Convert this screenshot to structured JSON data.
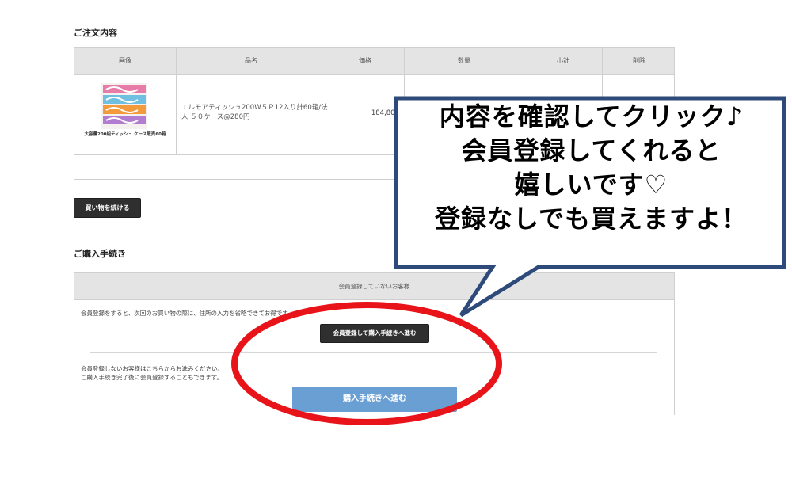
{
  "order": {
    "title": "ご注文内容",
    "headers": [
      "画像",
      "品名",
      "価格",
      "数量",
      "小計",
      "削除"
    ],
    "item": {
      "image_caption": "大容量200組ティッシュ ケース販売60箱",
      "name": "エルモアティッシュ200W５Ｐ12入り計60箱/法人 ５０ケース@280円",
      "price": "184,800"
    },
    "continue_button": "買い物を続ける"
  },
  "procedure": {
    "title": "ご購入手続き",
    "header": "会員登録していないお客様",
    "register_note": "会員登録をすると、次回のお買い物の際に、住所の入力を省略できてお得です。",
    "register_button": "会員登録して購入手続きへ進む",
    "guest_note_1": "会員登録しないお客様はこちらからお進みください。",
    "guest_note_2": "ご購入手続き完了後に会員登録することもできます。",
    "guest_button": "購入手続きへ進む"
  },
  "callout": {
    "line1": "内容を確認してクリック♪",
    "line2": "会員登録してくれると",
    "line3": "嬉しいです♡",
    "line4": "登録なしでも買えますよ！"
  },
  "colors": {
    "callout_border": "#2e4a7a",
    "highlight_ellipse": "#e8141a",
    "guest_button": "#6a9fd4"
  }
}
